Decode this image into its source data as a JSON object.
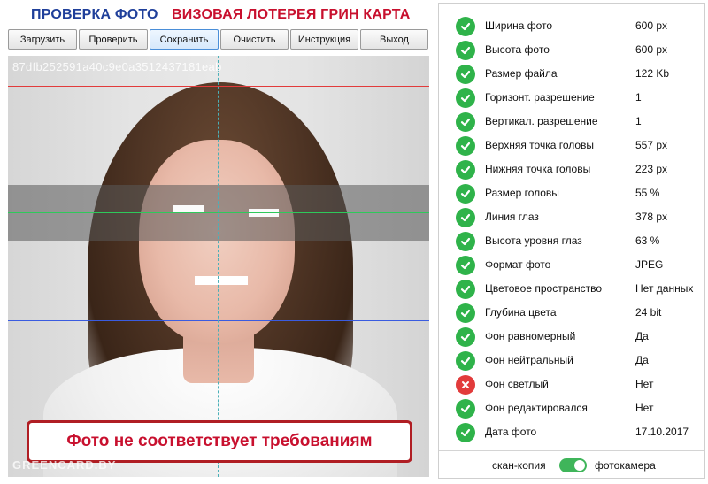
{
  "header": {
    "title_left": "ПРОВЕРКА ФОТО",
    "title_right": "ВИЗОВАЯ ЛОТЕРЕЯ ГРИН КАРТА"
  },
  "toolbar": {
    "upload": "Загрузить",
    "check": "Проверить",
    "save": "Сохранить",
    "clear": "Очистить",
    "instructions": "Инструкция",
    "exit": "Выход"
  },
  "photo": {
    "hash": "87dfb252591a40c9e0a3512437181eab",
    "warning": "Фото не соответствует требованиям",
    "watermark": "GREENCARD.BY"
  },
  "checks": [
    {
      "label": "Ширина фото",
      "value": "600 px",
      "status": "ok"
    },
    {
      "label": "Высота фото",
      "value": "600 px",
      "status": "ok"
    },
    {
      "label": "Размер файла",
      "value": "122 Kb",
      "status": "ok"
    },
    {
      "label": "Горизонт. разрешение",
      "value": "1",
      "status": "ok"
    },
    {
      "label": "Вертикал. разрешение",
      "value": "1",
      "status": "ok"
    },
    {
      "label": "Верхняя точка головы",
      "value": "557 px",
      "status": "ok"
    },
    {
      "label": "Нижняя точка головы",
      "value": "223 px",
      "status": "ok"
    },
    {
      "label": "Размер головы",
      "value": "55 %",
      "status": "ok"
    },
    {
      "label": "Линия глаз",
      "value": "378 px",
      "status": "ok"
    },
    {
      "label": "Высота уровня глаз",
      "value": "63 %",
      "status": "ok"
    },
    {
      "label": "Формат фото",
      "value": "JPEG",
      "status": "ok"
    },
    {
      "label": "Цветовое пространство",
      "value": "Нет данных",
      "status": "ok"
    },
    {
      "label": "Глубина цвета",
      "value": "24 bit",
      "status": "ok"
    },
    {
      "label": "Фон равномерный",
      "value": "Да",
      "status": "ok"
    },
    {
      "label": "Фон нейтральный",
      "value": "Да",
      "status": "ok"
    },
    {
      "label": "Фон светлый",
      "value": "Нет",
      "status": "fail"
    },
    {
      "label": "Фон редактировался",
      "value": "Нет",
      "status": "ok"
    },
    {
      "label": "Дата фото",
      "value": "17.10.2017",
      "status": "ok"
    }
  ],
  "footer": {
    "left_label": "скан-копия",
    "right_label": "фотокамера",
    "toggle_state": "on"
  },
  "colors": {
    "ok": "#2fb34a",
    "fail": "#e23b3b",
    "title_blue": "#1f3f9a",
    "title_red": "#c8102e"
  }
}
